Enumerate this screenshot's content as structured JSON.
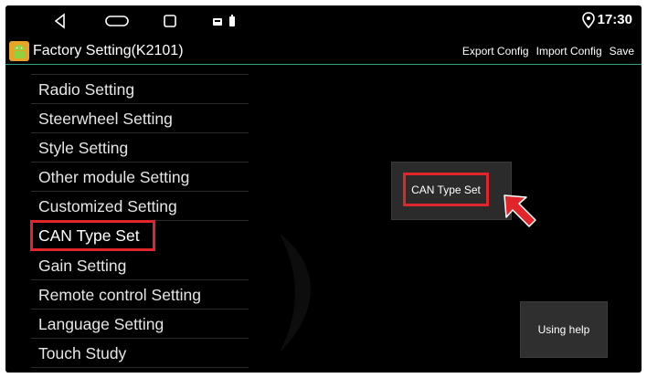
{
  "statusbar": {
    "time": "17:30",
    "icons": [
      "back-icon",
      "home-icon",
      "recent-apps-icon",
      "media-icon",
      "battery-icon",
      "location-icon"
    ]
  },
  "titlebar": {
    "title": "Factory Setting(K2101)",
    "actions": {
      "export_label": "Export Config",
      "import_label": "Import Config",
      "save_label": "Save"
    }
  },
  "menu": {
    "items": [
      {
        "label": ""
      },
      {
        "label": "Radio Setting"
      },
      {
        "label": "Steerwheel Setting"
      },
      {
        "label": "Style Setting"
      },
      {
        "label": "Other module Setting"
      },
      {
        "label": "Customized Setting"
      },
      {
        "label": "CAN Type Set"
      },
      {
        "label": "Gain Setting"
      },
      {
        "label": "Remote control Setting"
      },
      {
        "label": "Language Setting"
      },
      {
        "label": "Touch Study"
      }
    ],
    "selected": "CAN Type Set"
  },
  "content": {
    "can_button_label": "CAN Type Set",
    "help_button_label": "Using help"
  },
  "colors": {
    "background": "#000000",
    "highlight": "#e0262b",
    "title_underline": "#2fa37e",
    "text": "#ffffff"
  }
}
